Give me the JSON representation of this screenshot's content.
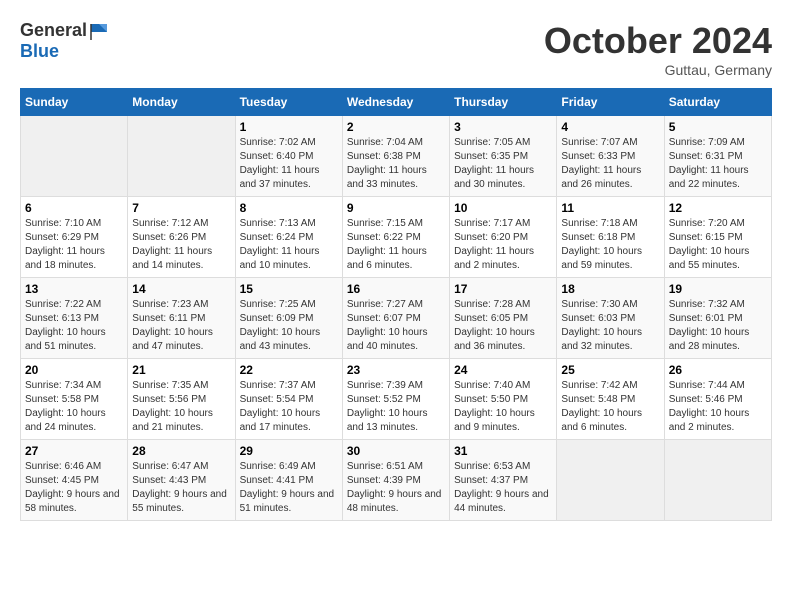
{
  "logo": {
    "general": "General",
    "blue": "Blue"
  },
  "title": {
    "month": "October 2024",
    "location": "Guttau, Germany"
  },
  "weekdays": [
    "Sunday",
    "Monday",
    "Tuesday",
    "Wednesday",
    "Thursday",
    "Friday",
    "Saturday"
  ],
  "weeks": [
    [
      null,
      null,
      {
        "day": 1,
        "sunrise": "7:02 AM",
        "sunset": "6:40 PM",
        "daylight": "11 hours and 37 minutes."
      },
      {
        "day": 2,
        "sunrise": "7:04 AM",
        "sunset": "6:38 PM",
        "daylight": "11 hours and 33 minutes."
      },
      {
        "day": 3,
        "sunrise": "7:05 AM",
        "sunset": "6:35 PM",
        "daylight": "11 hours and 30 minutes."
      },
      {
        "day": 4,
        "sunrise": "7:07 AM",
        "sunset": "6:33 PM",
        "daylight": "11 hours and 26 minutes."
      },
      {
        "day": 5,
        "sunrise": "7:09 AM",
        "sunset": "6:31 PM",
        "daylight": "11 hours and 22 minutes."
      }
    ],
    [
      {
        "day": 6,
        "sunrise": "7:10 AM",
        "sunset": "6:29 PM",
        "daylight": "11 hours and 18 minutes."
      },
      {
        "day": 7,
        "sunrise": "7:12 AM",
        "sunset": "6:26 PM",
        "daylight": "11 hours and 14 minutes."
      },
      {
        "day": 8,
        "sunrise": "7:13 AM",
        "sunset": "6:24 PM",
        "daylight": "11 hours and 10 minutes."
      },
      {
        "day": 9,
        "sunrise": "7:15 AM",
        "sunset": "6:22 PM",
        "daylight": "11 hours and 6 minutes."
      },
      {
        "day": 10,
        "sunrise": "7:17 AM",
        "sunset": "6:20 PM",
        "daylight": "11 hours and 2 minutes."
      },
      {
        "day": 11,
        "sunrise": "7:18 AM",
        "sunset": "6:18 PM",
        "daylight": "10 hours and 59 minutes."
      },
      {
        "day": 12,
        "sunrise": "7:20 AM",
        "sunset": "6:15 PM",
        "daylight": "10 hours and 55 minutes."
      }
    ],
    [
      {
        "day": 13,
        "sunrise": "7:22 AM",
        "sunset": "6:13 PM",
        "daylight": "10 hours and 51 minutes."
      },
      {
        "day": 14,
        "sunrise": "7:23 AM",
        "sunset": "6:11 PM",
        "daylight": "10 hours and 47 minutes."
      },
      {
        "day": 15,
        "sunrise": "7:25 AM",
        "sunset": "6:09 PM",
        "daylight": "10 hours and 43 minutes."
      },
      {
        "day": 16,
        "sunrise": "7:27 AM",
        "sunset": "6:07 PM",
        "daylight": "10 hours and 40 minutes."
      },
      {
        "day": 17,
        "sunrise": "7:28 AM",
        "sunset": "6:05 PM",
        "daylight": "10 hours and 36 minutes."
      },
      {
        "day": 18,
        "sunrise": "7:30 AM",
        "sunset": "6:03 PM",
        "daylight": "10 hours and 32 minutes."
      },
      {
        "day": 19,
        "sunrise": "7:32 AM",
        "sunset": "6:01 PM",
        "daylight": "10 hours and 28 minutes."
      }
    ],
    [
      {
        "day": 20,
        "sunrise": "7:34 AM",
        "sunset": "5:58 PM",
        "daylight": "10 hours and 24 minutes."
      },
      {
        "day": 21,
        "sunrise": "7:35 AM",
        "sunset": "5:56 PM",
        "daylight": "10 hours and 21 minutes."
      },
      {
        "day": 22,
        "sunrise": "7:37 AM",
        "sunset": "5:54 PM",
        "daylight": "10 hours and 17 minutes."
      },
      {
        "day": 23,
        "sunrise": "7:39 AM",
        "sunset": "5:52 PM",
        "daylight": "10 hours and 13 minutes."
      },
      {
        "day": 24,
        "sunrise": "7:40 AM",
        "sunset": "5:50 PM",
        "daylight": "10 hours and 9 minutes."
      },
      {
        "day": 25,
        "sunrise": "7:42 AM",
        "sunset": "5:48 PM",
        "daylight": "10 hours and 6 minutes."
      },
      {
        "day": 26,
        "sunrise": "7:44 AM",
        "sunset": "5:46 PM",
        "daylight": "10 hours and 2 minutes."
      }
    ],
    [
      {
        "day": 27,
        "sunrise": "6:46 AM",
        "sunset": "4:45 PM",
        "daylight": "9 hours and 58 minutes."
      },
      {
        "day": 28,
        "sunrise": "6:47 AM",
        "sunset": "4:43 PM",
        "daylight": "9 hours and 55 minutes."
      },
      {
        "day": 29,
        "sunrise": "6:49 AM",
        "sunset": "4:41 PM",
        "daylight": "9 hours and 51 minutes."
      },
      {
        "day": 30,
        "sunrise": "6:51 AM",
        "sunset": "4:39 PM",
        "daylight": "9 hours and 48 minutes."
      },
      {
        "day": 31,
        "sunrise": "6:53 AM",
        "sunset": "4:37 PM",
        "daylight": "9 hours and 44 minutes."
      },
      null,
      null
    ]
  ]
}
